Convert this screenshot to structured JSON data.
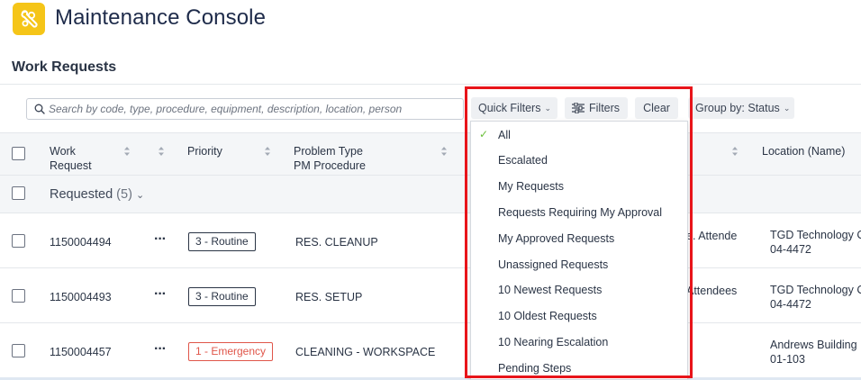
{
  "header": {
    "title": "Maintenance Console"
  },
  "section": {
    "title": "Work Requests"
  },
  "toolbar": {
    "search_placeholder": "Search by code, type, procedure, equipment, description, location, person",
    "quick_filters_label": "Quick Filters",
    "filters_label": "Filters",
    "clear_label": "Clear",
    "group_by_label": "Group by: Status"
  },
  "table": {
    "columns": {
      "work_request_line1": "Work",
      "work_request_line2": "Request",
      "priority": "Priority",
      "problem_type_line1": "Problem Type",
      "problem_type_line2": "PM Procedure",
      "location": "Location (Name)"
    },
    "group": {
      "label": "Requested",
      "count": "(5)"
    },
    "rows": [
      {
        "id": "1150004494",
        "priority": "3 - Routine",
        "problem": "RES. CLEANUP",
        "partial": "e. Attende",
        "location_line1": "TGD Technology C",
        "location_line2": "04-4472"
      },
      {
        "id": "1150004493",
        "priority": "3 - Routine",
        "problem": "RES. SETUP",
        "partial": "Attendees",
        "location_line1": "TGD Technology C",
        "location_line2": "04-4472"
      },
      {
        "id": "1150004457",
        "priority": "1 - Emergency",
        "problem": "CLEANING - WORKSPACE",
        "partial": "",
        "location_line1": "Andrews Building",
        "location_line2": "01-103"
      }
    ]
  },
  "quick_filters_menu": {
    "items": [
      "All",
      "Escalated",
      "My Requests",
      "Requests Requiring My Approval",
      "My Approved Requests",
      "Unassigned Requests",
      "10 Newest Requests",
      "10 Oldest Requests",
      "10 Nearing Escalation",
      "Pending Steps"
    ],
    "selected": "All"
  },
  "colors": {
    "logo": "#f5c518",
    "highlight_border": "#e8141a",
    "emergency": "#e0564a",
    "check": "#6bbf3a"
  }
}
